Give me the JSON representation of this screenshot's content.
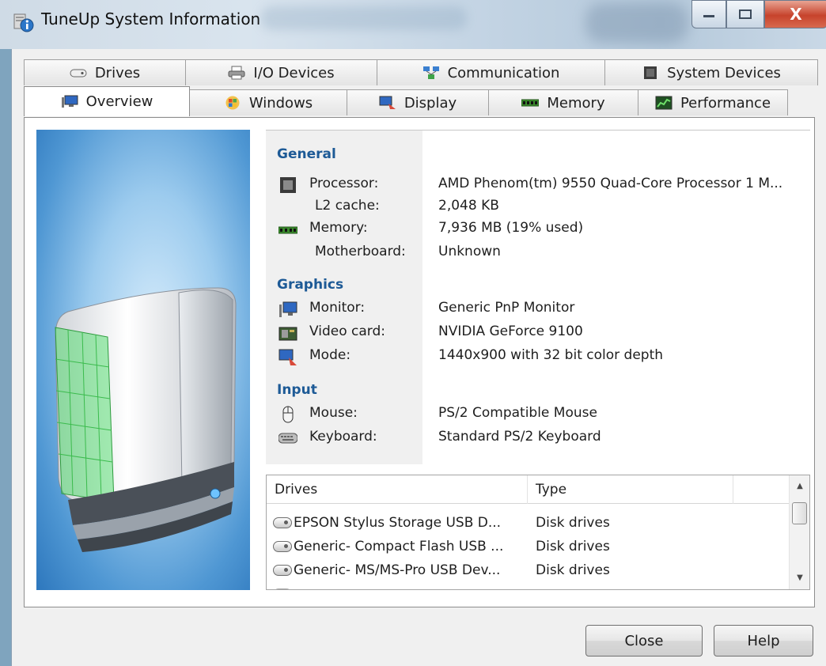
{
  "window": {
    "title": "TuneUp System Information",
    "close_glyph": "X"
  },
  "tabs": {
    "row1": [
      {
        "label": "Drives",
        "icon": "drive-icon"
      },
      {
        "label": "I/O Devices",
        "icon": "printer-icon"
      },
      {
        "label": "Communication",
        "icon": "network-icon"
      },
      {
        "label": "System Devices",
        "icon": "chip-icon"
      }
    ],
    "row2": [
      {
        "label": "Overview",
        "icon": "monitor-icon",
        "active": true
      },
      {
        "label": "Windows",
        "icon": "windows-logo-icon"
      },
      {
        "label": "Display",
        "icon": "display-icon"
      },
      {
        "label": "Memory",
        "icon": "memory-icon"
      },
      {
        "label": "Performance",
        "icon": "performance-icon"
      }
    ]
  },
  "overview": {
    "general": {
      "heading": "General",
      "processor_label": "Processor:",
      "processor_value": "AMD Phenom(tm) 9550 Quad-Core Processor 1 M...",
      "l2_label": "L2 cache:",
      "l2_value": "2,048 KB",
      "memory_label": "Memory:",
      "memory_value": "7,936 MB (19% used)",
      "motherboard_label": "Motherboard:",
      "motherboard_value": "Unknown"
    },
    "graphics": {
      "heading": "Graphics",
      "monitor_label": "Monitor:",
      "monitor_value": "Generic PnP Monitor",
      "videocard_label": "Video card:",
      "videocard_value": "NVIDIA GeForce 9100",
      "mode_label": "Mode:",
      "mode_value": "1440x900 with 32 bit color depth"
    },
    "input": {
      "heading": "Input",
      "mouse_label": "Mouse:",
      "mouse_value": "PS/2 Compatible Mouse",
      "keyboard_label": "Keyboard:",
      "keyboard_value": "Standard PS/2 Keyboard"
    }
  },
  "drives_list": {
    "columns": [
      "Drives",
      "Type"
    ],
    "rows": [
      {
        "name": "EPSON Stylus Storage USB D...",
        "type": "Disk drives"
      },
      {
        "name": "Generic- Compact Flash USB ...",
        "type": "Disk drives"
      },
      {
        "name": "Generic- MS/MS-Pro USB Dev...",
        "type": "Disk drives"
      }
    ]
  },
  "buttons": {
    "close": "Close",
    "help": "Help"
  },
  "colors": {
    "section_heading": "#1d5a96",
    "panel_bg": "#ffffff",
    "window_bg": "#f0f0f0"
  }
}
